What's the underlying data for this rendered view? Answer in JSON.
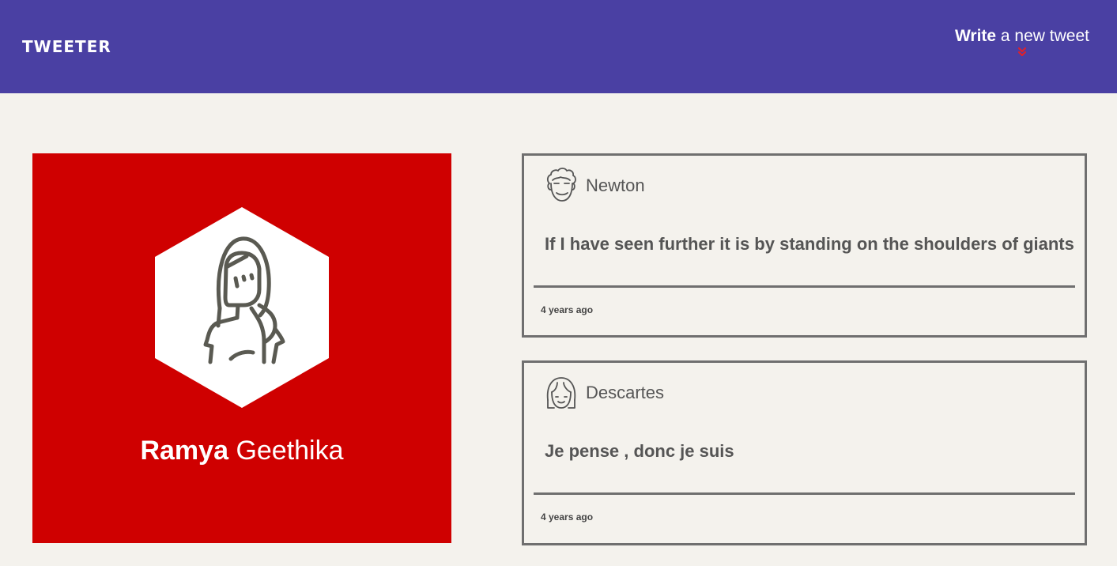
{
  "header": {
    "logo": "TWEETER",
    "compose_strong": "Write",
    "compose_rest": "a new tweet",
    "compose_icon": "double-chevron-down-icon"
  },
  "colors": {
    "header_bg": "#4a40a3",
    "page_bg": "#f4f2ed",
    "profile_bg": "#cf0000",
    "accent_chevron": "#e0202a",
    "border": "#6f6f6f"
  },
  "profile": {
    "first_name": "Ramya",
    "last_name": "Geethika",
    "avatar_icon": "female-avatar-icon"
  },
  "tweets": [
    {
      "author": "Newton",
      "avatar_icon": "curly-hair-avatar-icon",
      "text": "If I have seen further it is by standing on the shoulders of giants",
      "time": "4 years ago"
    },
    {
      "author": "Descartes",
      "avatar_icon": "girl-avatar-icon",
      "text": "Je pense , donc je suis",
      "time": "4 years ago"
    }
  ]
}
